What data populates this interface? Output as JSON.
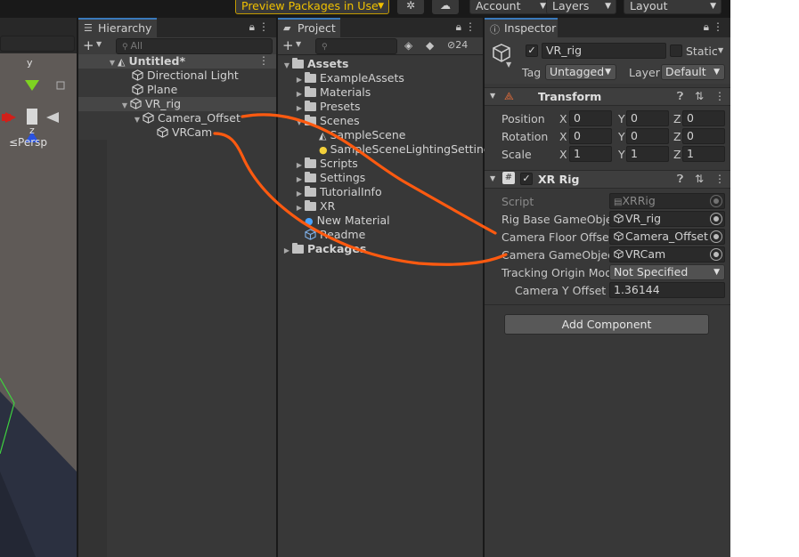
{
  "toolbar": {
    "preview_packages": "Preview Packages in Use",
    "account": "Account",
    "layers": "Layers",
    "layout": "Layout"
  },
  "scene_view": {
    "axis_y": "y",
    "axis_z": "z",
    "persp_label": "≤Persp"
  },
  "hierarchy": {
    "tab_label": "Hierarchy",
    "search_placeholder": "All",
    "items": [
      {
        "label": "Untitled*"
      },
      {
        "label": "Directional Light"
      },
      {
        "label": "Plane"
      },
      {
        "label": "VR_rig"
      },
      {
        "label": "Camera_Offset"
      },
      {
        "label": "VRCam"
      }
    ]
  },
  "project": {
    "tab_label": "Project",
    "hidden_count": "24",
    "items": [
      {
        "label": "Assets"
      },
      {
        "label": "ExampleAssets"
      },
      {
        "label": "Materials"
      },
      {
        "label": "Presets"
      },
      {
        "label": "Scenes"
      },
      {
        "label": "SampleScene"
      },
      {
        "label": "SampleSceneLightingSettings"
      },
      {
        "label": "Scripts"
      },
      {
        "label": "Settings"
      },
      {
        "label": "TutorialInfo"
      },
      {
        "label": "XR"
      },
      {
        "label": "New Material"
      },
      {
        "label": "Readme"
      },
      {
        "label": "Packages"
      }
    ]
  },
  "inspector": {
    "tab_label": "Inspector",
    "object_name": "VR_rig",
    "static_label": "Static",
    "tag_label": "Tag",
    "tag_value": "Untagged",
    "layer_label": "Layer",
    "layer_value": "Default",
    "transform": {
      "title": "Transform",
      "position_label": "Position",
      "rotation_label": "Rotation",
      "scale_label": "Scale",
      "x": "X",
      "y": "Y",
      "z": "Z",
      "position": [
        "0",
        "0",
        "0"
      ],
      "rotation": [
        "0",
        "0",
        "0"
      ],
      "scale": [
        "1",
        "1",
        "1"
      ]
    },
    "xr_rig": {
      "title": "XR Rig",
      "script_label": "Script",
      "script_value": "XRRig",
      "rig_base_label": "Rig Base GameObjec",
      "rig_base_value": "VR_rig",
      "camera_floor_label": "Camera Floor Offset G",
      "camera_floor_value": "Camera_Offset",
      "camera_go_label": "Camera GameObject",
      "camera_go_value": "VRCam",
      "tracking_label": "Tracking Origin Mode",
      "tracking_value": "Not Specified",
      "camera_y_label": "Camera Y Offset",
      "camera_y_value": "1.36144"
    },
    "add_component": "Add Component"
  },
  "colors": {
    "annotation_stroke": "#ff5a10",
    "tab_accent": "#3a79bb",
    "preview_border": "#c29a00"
  }
}
